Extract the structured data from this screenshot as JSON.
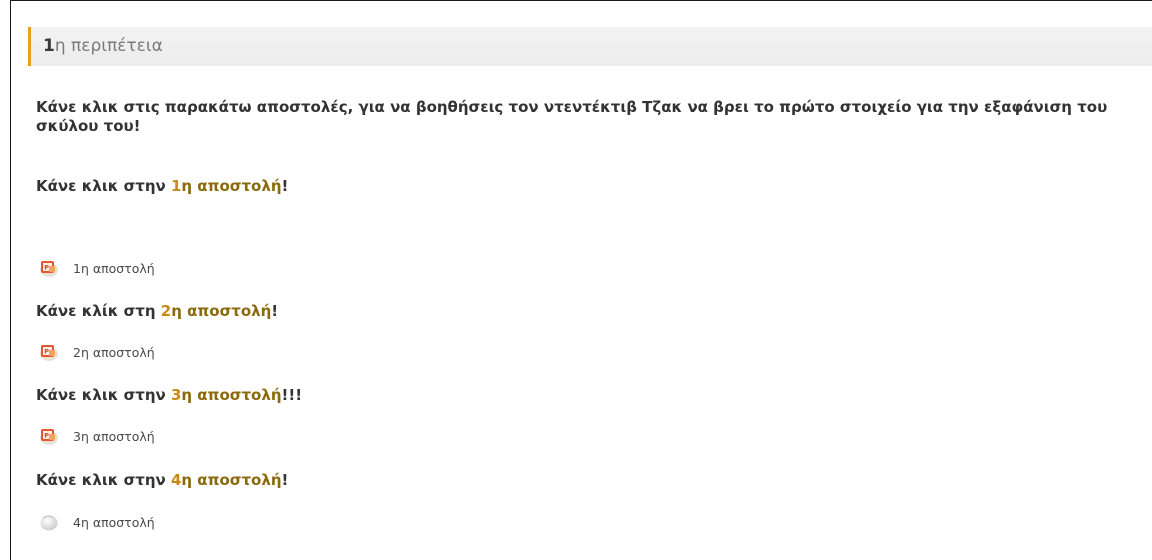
{
  "section": {
    "title_number": "1",
    "title_rest": "η περιπέτεια"
  },
  "intro": "Κάνε κλικ στις παρακάτω αποστολές, για να βοηθήσεις τον ντεντέκτιβ Τζακ να βρει το πρώτο στοιχείο για την εξαφάνιση του σκύλου του!",
  "missions": [
    {
      "prompt_before": "Κάνε κλικ στην ",
      "prompt_number": "1",
      "prompt_link": "η αποστολή",
      "prompt_after": "!",
      "activity_label": "1η αποστολή",
      "icon": "powerpoint-file-icon"
    },
    {
      "prompt_before": "Κάνε κλίκ στη ",
      "prompt_number": "2",
      "prompt_link": "η αποστολή",
      "prompt_after": "!",
      "activity_label": "2η αποστολή",
      "icon": "powerpoint-file-icon"
    },
    {
      "prompt_before": "Κάνε κλικ στην ",
      "prompt_number": "3",
      "prompt_link": "η αποστολή",
      "prompt_after": "!!!",
      "activity_label": "3η αποστολή",
      "icon": "powerpoint-file-icon"
    },
    {
      "prompt_before": "Κάνε κλικ στην ",
      "prompt_number": "4",
      "prompt_link": "η αποστολή",
      "prompt_after": "!",
      "activity_label": "4η αποστολή",
      "icon": "generic-file-icon"
    }
  ],
  "colors": {
    "header_accent": "#e8a11f",
    "link_text": "#8a6a0c",
    "link_number": "#c98a12",
    "body_text": "#333333"
  }
}
